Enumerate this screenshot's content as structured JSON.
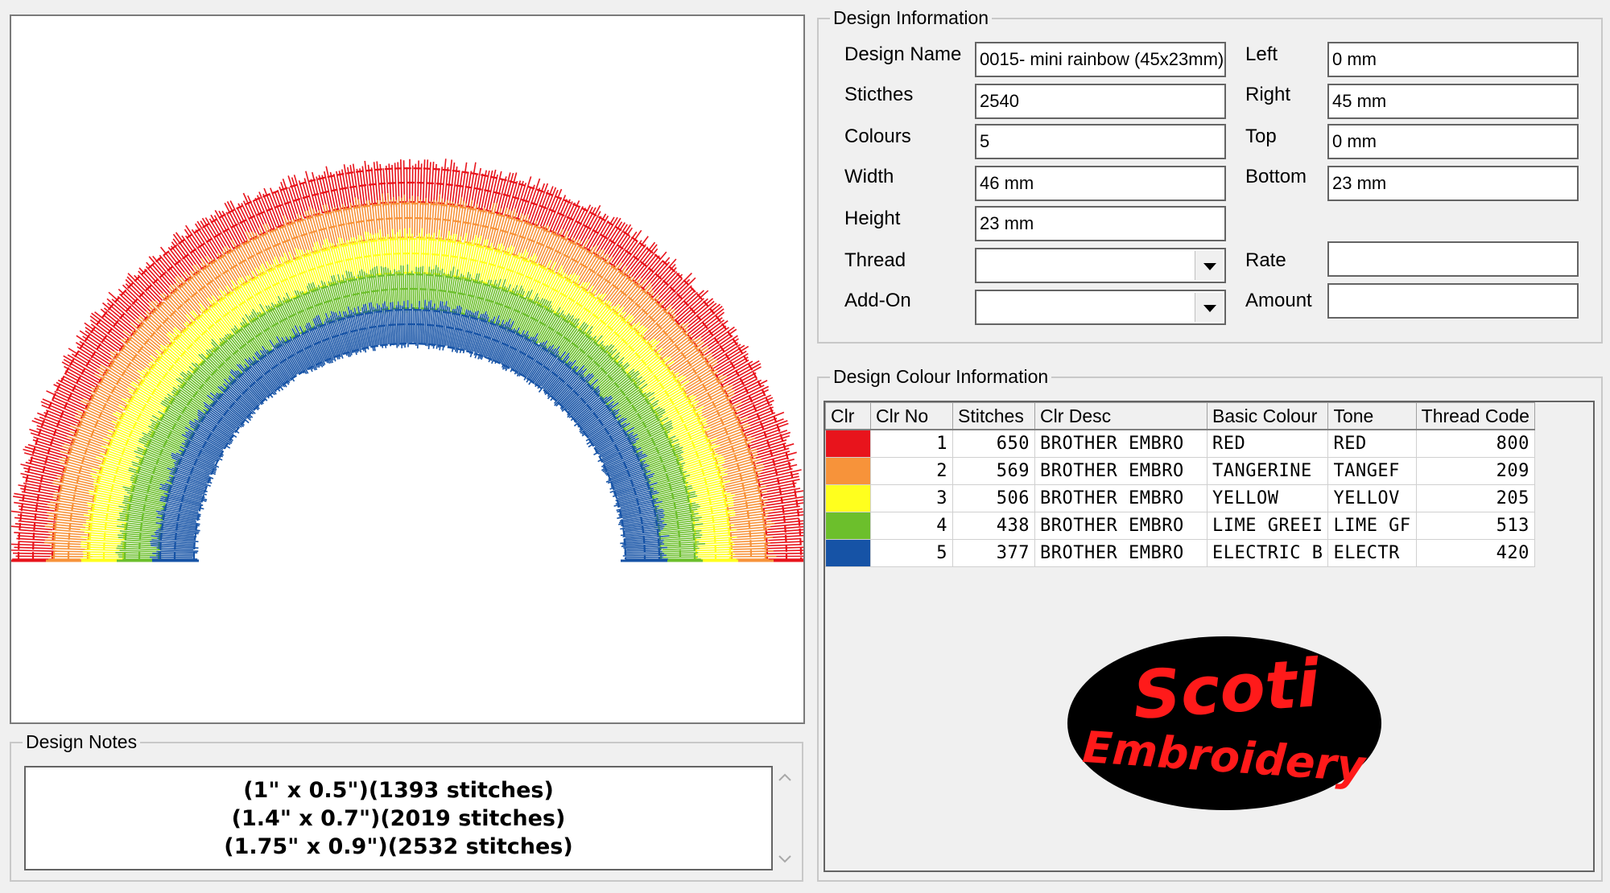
{
  "design_information": {
    "title": "Design Information",
    "labels": {
      "design_name": "Design Name",
      "stitches": "Sticthes",
      "colours": "Colours",
      "width": "Width",
      "height": "Height",
      "thread": "Thread",
      "addon": "Add-On",
      "left": "Left",
      "right": "Right",
      "top": "Top",
      "bottom": "Bottom",
      "rate": "Rate",
      "amount": "Amount"
    },
    "values": {
      "design_name": "0015- mini rainbow (45x23mm)",
      "stitches": "2540",
      "colours": "5",
      "width": "46 mm",
      "height": "23 mm",
      "thread": "",
      "addon": "",
      "left": "0 mm",
      "right": "45 mm",
      "top": "0 mm",
      "bottom": "23 mm",
      "rate": "",
      "amount": ""
    }
  },
  "design_colour_information": {
    "title": "Design Colour Information",
    "columns": [
      "Clr",
      "Clr No",
      "Stitches",
      "Clr Desc",
      "Basic Colour",
      "Tone",
      "Thread Code"
    ],
    "rows": [
      {
        "swatch": "#e8141c",
        "clr_no": "1",
        "stitches": "650",
        "desc": "BROTHER EMBRO",
        "basic": "RED",
        "tone": "RED",
        "code": "800"
      },
      {
        "swatch": "#f7933a",
        "clr_no": "2",
        "stitches": "569",
        "desc": "BROTHER EMBRO",
        "basic": "TANGERINE",
        "tone": "TANGEF",
        "code": "209"
      },
      {
        "swatch": "#ffff1e",
        "clr_no": "3",
        "stitches": "506",
        "desc": "BROTHER EMBRO",
        "basic": "YELLOW",
        "tone": "YELLOV",
        "code": "205"
      },
      {
        "swatch": "#6cbf2c",
        "clr_no": "4",
        "stitches": "438",
        "desc": "BROTHER EMBRO",
        "basic": "LIME GREEI",
        "tone": "LIME GF",
        "code": "513"
      },
      {
        "swatch": "#1653a6",
        "clr_no": "5",
        "stitches": "377",
        "desc": "BROTHER EMBRO",
        "basic": "ELECTRIC B",
        "tone": "ELECTR",
        "code": "420"
      }
    ]
  },
  "design_notes": {
    "title": "Design Notes",
    "lines": [
      "(1\" x 0.5\")(1393 stitches)",
      "(1.4\" x 0.7\")(2019 stitches)",
      "(1.75\" x 0.9\")(2532 stitches)"
    ]
  },
  "logo": {
    "line1": "Scoti",
    "line2": "Embroidery",
    "text_color": "#ff1a1a",
    "bg_color": "#000000"
  },
  "preview": {
    "band_colors": [
      "#e8141c",
      "#f7933a",
      "#ffff1e",
      "#6cbf2c",
      "#1653a6"
    ]
  }
}
